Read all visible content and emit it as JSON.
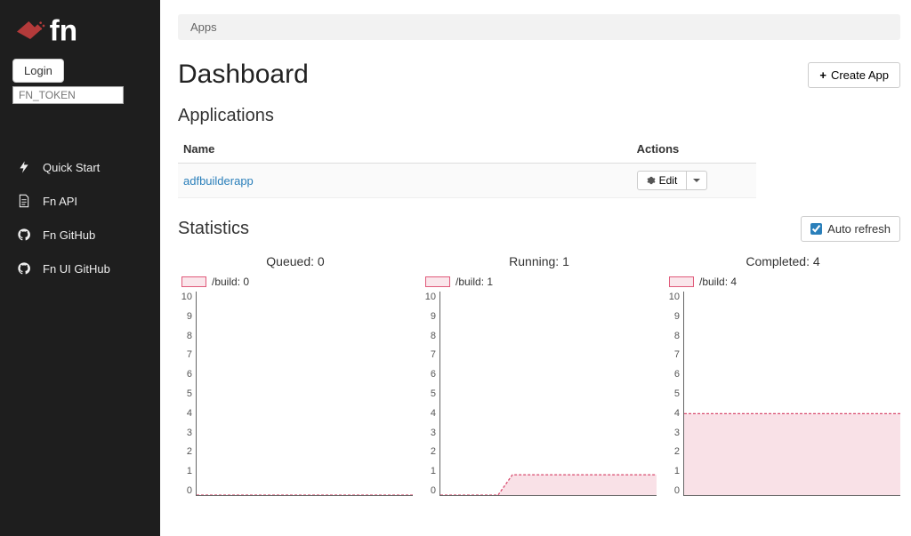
{
  "brand": "fn",
  "login": {
    "button": "Login",
    "token_placeholder": "FN_TOKEN"
  },
  "nav": [
    {
      "id": "quick-start",
      "label": "Quick Start"
    },
    {
      "id": "fn-api",
      "label": "Fn API"
    },
    {
      "id": "fn-github",
      "label": "Fn GitHub"
    },
    {
      "id": "fn-ui-github",
      "label": "Fn UI GitHub"
    }
  ],
  "breadcrumb": "Apps",
  "page_title": "Dashboard",
  "create_button": "Create App",
  "sections": {
    "applications": "Applications",
    "statistics": "Statistics"
  },
  "table": {
    "headers": {
      "name": "Name",
      "actions": "Actions"
    },
    "rows": [
      {
        "name": "adfbuilderapp",
        "edit_label": "Edit"
      }
    ]
  },
  "auto_refresh": {
    "label": "Auto refresh",
    "checked": true
  },
  "chart_data": [
    {
      "type": "area",
      "title": "Queued: 0",
      "legend": "/build: 0",
      "ylim": [
        0,
        10
      ],
      "y_ticks": [
        10,
        9,
        8,
        7,
        6,
        5,
        4,
        3,
        2,
        1,
        0
      ],
      "values": [
        0,
        0,
        0,
        0,
        0,
        0,
        0,
        0,
        0,
        0,
        0,
        0,
        0,
        0,
        0,
        0
      ]
    },
    {
      "type": "area",
      "title": "Running: 1",
      "legend": "/build: 1",
      "ylim": [
        0,
        10
      ],
      "y_ticks": [
        10,
        9,
        8,
        7,
        6,
        5,
        4,
        3,
        2,
        1,
        0
      ],
      "values": [
        0,
        0,
        0,
        0,
        0,
        1,
        1,
        1,
        1,
        1,
        1,
        1,
        1,
        1,
        1,
        1
      ]
    },
    {
      "type": "area",
      "title": "Completed: 4",
      "legend": "/build: 4",
      "ylim": [
        0,
        10
      ],
      "y_ticks": [
        10,
        9,
        8,
        7,
        6,
        5,
        4,
        3,
        2,
        1,
        0
      ],
      "values": [
        4,
        4,
        4,
        4,
        4,
        4,
        4,
        4,
        4,
        4,
        4,
        4,
        4,
        4,
        4,
        4
      ]
    }
  ]
}
